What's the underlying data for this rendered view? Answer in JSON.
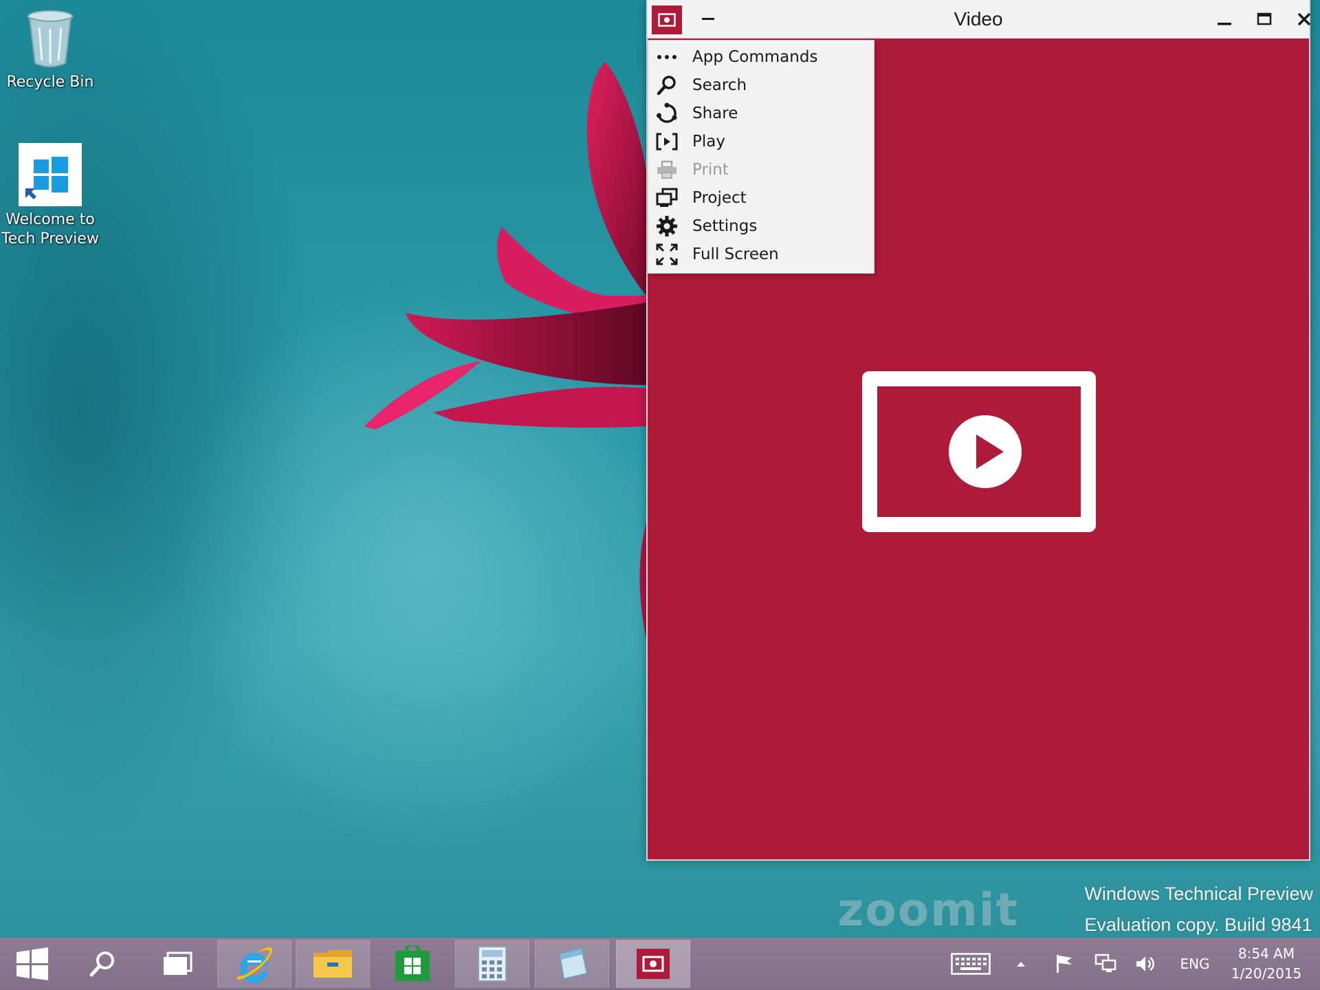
{
  "desktop": {
    "icons": [
      {
        "label": "Recycle Bin"
      },
      {
        "label_line1": "Welcome to",
        "label_line2": "Tech Preview"
      }
    ]
  },
  "window": {
    "title": "Video",
    "accent_color": "#ae1a3a",
    "controls": [
      "minimize-icon",
      "maximize-icon",
      "close-icon"
    ]
  },
  "menu": {
    "items": [
      {
        "label": "App Commands",
        "icon": "more-dots-icon",
        "enabled": true
      },
      {
        "label": "Search",
        "icon": "search-icon",
        "enabled": true
      },
      {
        "label": "Share",
        "icon": "share-icon",
        "enabled": true
      },
      {
        "label": "Play",
        "icon": "play-icon",
        "enabled": true
      },
      {
        "label": "Print",
        "icon": "print-icon",
        "enabled": false
      },
      {
        "label": "Project",
        "icon": "project-icon",
        "enabled": true
      },
      {
        "label": "Settings",
        "icon": "gear-icon",
        "enabled": true
      },
      {
        "label": "Full Screen",
        "icon": "fullscreen-icon",
        "enabled": true
      }
    ]
  },
  "watermark": {
    "line1": "Windows Technical Preview",
    "line2": "Evaluation copy. Build 9841",
    "logo_text": "zoomit"
  },
  "taskbar": {
    "color": "#86738c",
    "apps": [
      "start-icon",
      "search-icon",
      "task-view-icon",
      "internet-explorer-icon",
      "file-explorer-icon",
      "store-icon",
      "calculator-icon",
      "notepad-icon",
      "video-app-icon"
    ],
    "tray": {
      "language": "ENG",
      "time": "8:54 AM",
      "date": "1/20/2015"
    }
  }
}
